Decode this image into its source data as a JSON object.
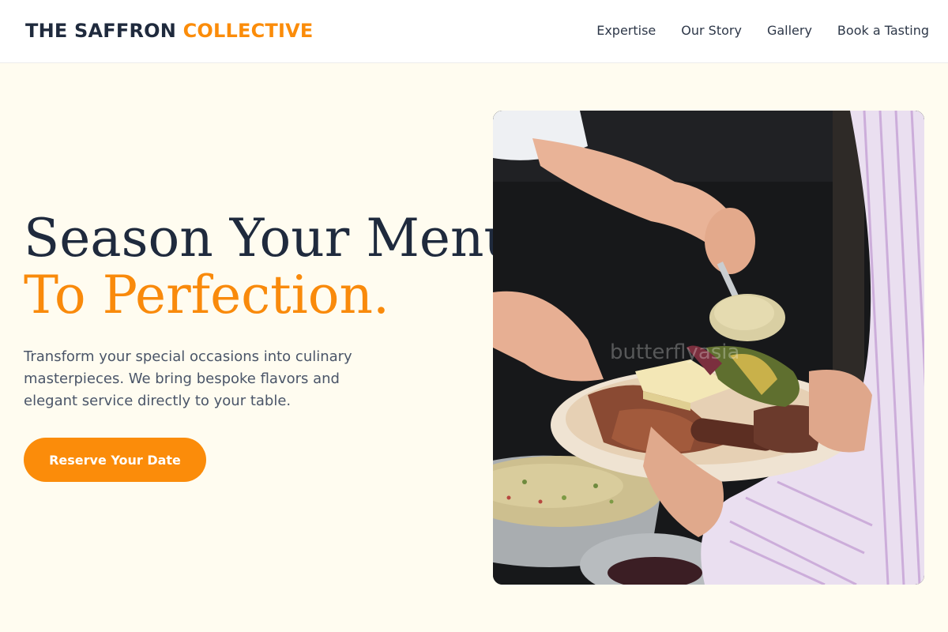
{
  "brand": {
    "main": "THE SAFFRON",
    "accent": "COLLECTIVE"
  },
  "nav": {
    "items": [
      {
        "label": "Expertise"
      },
      {
        "label": "Our Story"
      },
      {
        "label": "Gallery"
      },
      {
        "label": "Book a Tasting"
      }
    ]
  },
  "hero": {
    "title_line1": "Season Your Menu",
    "title_line2": "To Perfection.",
    "description": "Transform your special occasions into culinary masterpieces. We bring bespoke flavors and elegant service directly to your table.",
    "cta_label": "Reserve Your Date",
    "image_watermark": "butterflyasia"
  },
  "colors": {
    "accent": "#fb8c0a",
    "heading": "#1f2a3d",
    "body_text": "#4a5568",
    "background": "#fffcf0"
  }
}
